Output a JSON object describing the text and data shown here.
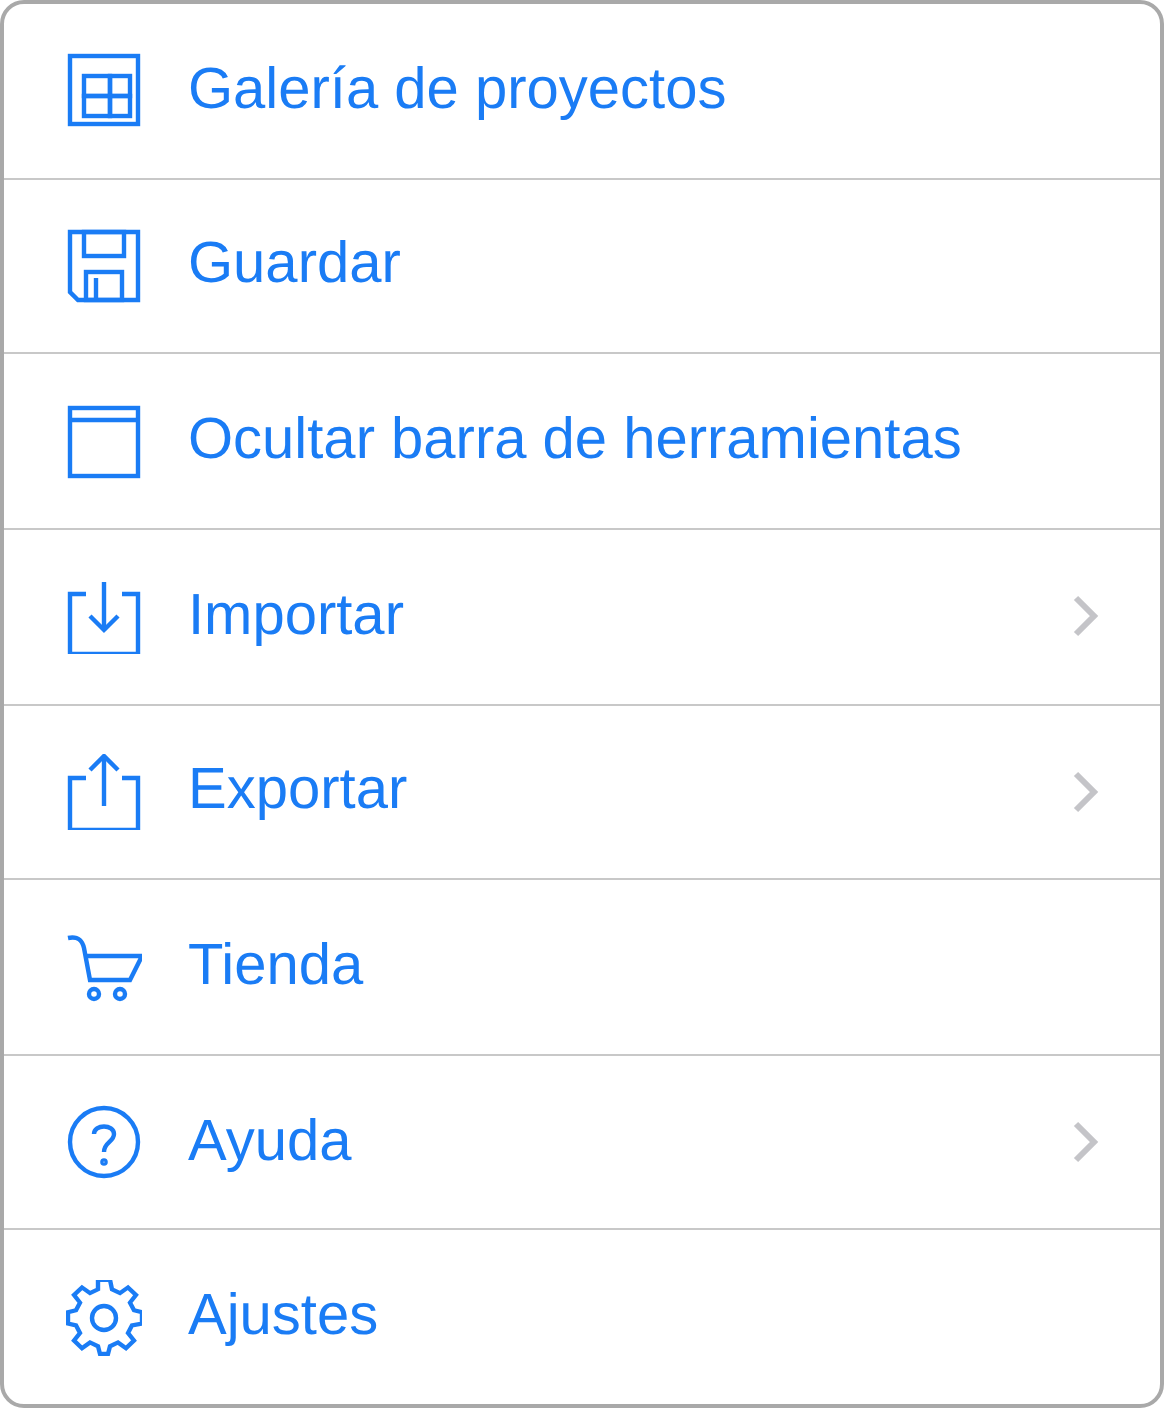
{
  "menu": {
    "items": [
      {
        "label": "Galería de proyectos",
        "submenu": false
      },
      {
        "label": "Guardar",
        "submenu": false
      },
      {
        "label": "Ocultar barra de herramientas",
        "submenu": false
      },
      {
        "label": "Importar",
        "submenu": true
      },
      {
        "label": "Exportar",
        "submenu": true
      },
      {
        "label": "Tienda",
        "submenu": false
      },
      {
        "label": "Ayuda",
        "submenu": true
      },
      {
        "label": "Ajustes",
        "submenu": false
      }
    ]
  }
}
